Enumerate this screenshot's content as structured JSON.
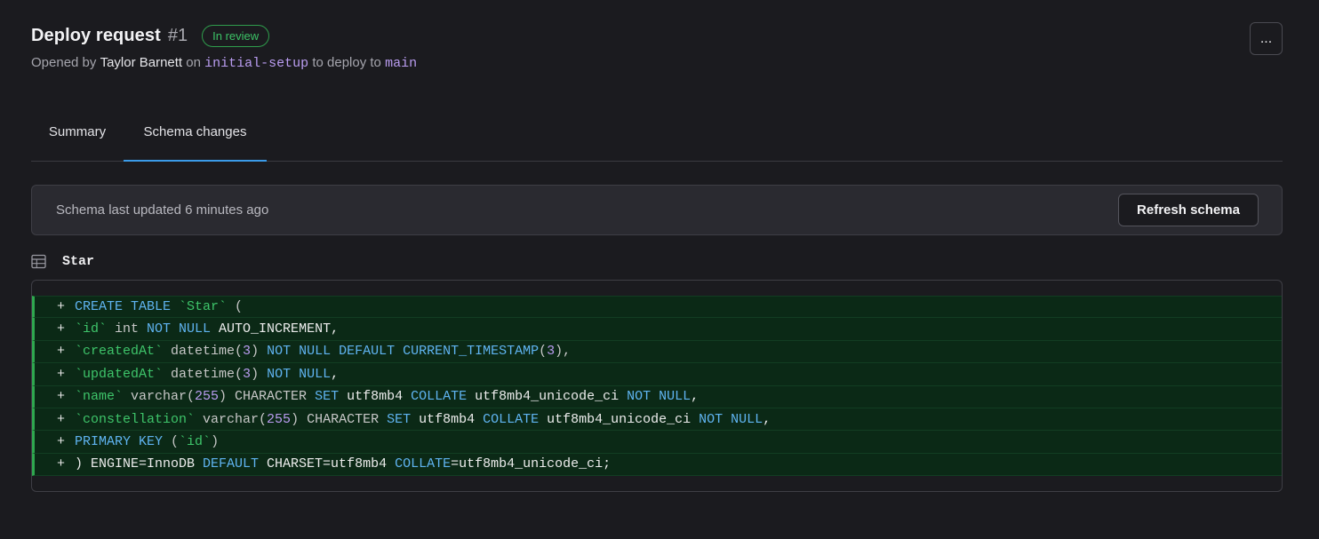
{
  "header": {
    "title": "Deploy request",
    "number": "#1",
    "status": "In review",
    "opened_by_prefix": "Opened by ",
    "author": "Taylor Barnett",
    "on_text": " on ",
    "source_branch": "initial-setup",
    "deploy_text": " to deploy to ",
    "target_branch": "main",
    "more_label": "..."
  },
  "tabs": [
    {
      "label": "Summary",
      "active": false
    },
    {
      "label": "Schema changes",
      "active": true
    }
  ],
  "info_bar": {
    "text": "Schema last updated 6 minutes ago",
    "refresh_label": "Refresh schema"
  },
  "table": {
    "icon": "table-icon",
    "name": "Star"
  },
  "diff": {
    "prefix": "+",
    "lines": [
      [
        {
          "t": "CREATE TABLE ",
          "c": "kw"
        },
        {
          "t": "`Star`",
          "c": "id"
        },
        {
          "t": " (",
          "c": "muted"
        }
      ],
      [
        {
          "t": "`id`",
          "c": "id"
        },
        {
          "t": " int ",
          "c": "muted"
        },
        {
          "t": "NOT NULL",
          "c": "kw"
        },
        {
          "t": " AUTO_INCREMENT,",
          "c": "plain"
        }
      ],
      [
        {
          "t": "`createdAt`",
          "c": "id"
        },
        {
          "t": " datetime(",
          "c": "muted"
        },
        {
          "t": "3",
          "c": "num"
        },
        {
          "t": ") ",
          "c": "muted"
        },
        {
          "t": "NOT NULL DEFAULT CURRENT_TIMESTAMP",
          "c": "kw"
        },
        {
          "t": "(",
          "c": "muted"
        },
        {
          "t": "3",
          "c": "num"
        },
        {
          "t": "),",
          "c": "muted"
        }
      ],
      [
        {
          "t": "`updatedAt`",
          "c": "id"
        },
        {
          "t": " datetime(",
          "c": "muted"
        },
        {
          "t": "3",
          "c": "num"
        },
        {
          "t": ") ",
          "c": "muted"
        },
        {
          "t": "NOT NULL",
          "c": "kw"
        },
        {
          "t": ",",
          "c": "plain"
        }
      ],
      [
        {
          "t": "`name`",
          "c": "id"
        },
        {
          "t": " varchar(",
          "c": "muted"
        },
        {
          "t": "255",
          "c": "num"
        },
        {
          "t": ") CHARACTER ",
          "c": "muted"
        },
        {
          "t": "SET",
          "c": "kw"
        },
        {
          "t": " utf8mb4 ",
          "c": "plain"
        },
        {
          "t": "COLLATE",
          "c": "kw"
        },
        {
          "t": " utf8mb4_unicode_ci ",
          "c": "plain"
        },
        {
          "t": "NOT NULL",
          "c": "kw"
        },
        {
          "t": ",",
          "c": "plain"
        }
      ],
      [
        {
          "t": "`constellation`",
          "c": "id"
        },
        {
          "t": " varchar(",
          "c": "muted"
        },
        {
          "t": "255",
          "c": "num"
        },
        {
          "t": ") CHARACTER ",
          "c": "muted"
        },
        {
          "t": "SET",
          "c": "kw"
        },
        {
          "t": " utf8mb4 ",
          "c": "plain"
        },
        {
          "t": "COLLATE",
          "c": "kw"
        },
        {
          "t": " utf8mb4_unicode_ci ",
          "c": "plain"
        },
        {
          "t": "NOT NULL",
          "c": "kw"
        },
        {
          "t": ",",
          "c": "plain"
        }
      ],
      [
        {
          "t": "PRIMARY KEY",
          "c": "kw"
        },
        {
          "t": " (",
          "c": "muted"
        },
        {
          "t": "`id`",
          "c": "id"
        },
        {
          "t": ")",
          "c": "muted"
        }
      ],
      [
        {
          "t": ") ENGINE=InnoDB ",
          "c": "plain"
        },
        {
          "t": "DEFAULT",
          "c": "kw"
        },
        {
          "t": " CHARSET=utf8mb4 ",
          "c": "plain"
        },
        {
          "t": "COLLATE",
          "c": "kw"
        },
        {
          "t": "=utf8mb4_unicode_ci;",
          "c": "plain"
        }
      ]
    ]
  }
}
